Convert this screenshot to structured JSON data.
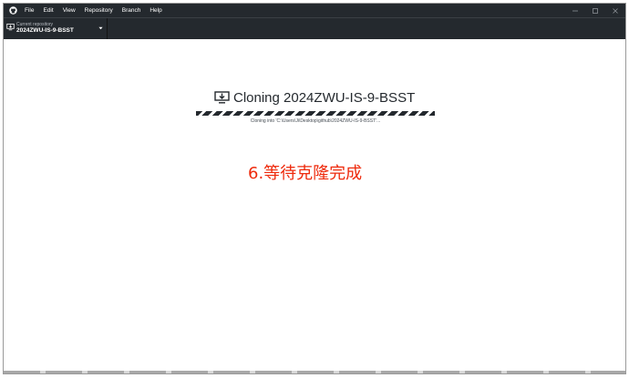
{
  "menu": {
    "items": [
      "File",
      "Edit",
      "View",
      "Repository",
      "Branch",
      "Help"
    ]
  },
  "toolbar": {
    "repository_caption": "Current repository",
    "repository_name": "2024ZWU-IS-9-BSST"
  },
  "clone": {
    "title": "Cloning 2024ZWU-IS-9-BSST",
    "status": "Cloning into 'C:\\Users\\Ji\\Desktop\\github\\2024ZWU-IS-9-BSST'..."
  },
  "annotation": {
    "text": "6.等待克隆完成",
    "color": "#ee2a0c"
  },
  "colors": {
    "titlebar": "#24292e",
    "accent_text": "#ee2a0c"
  }
}
